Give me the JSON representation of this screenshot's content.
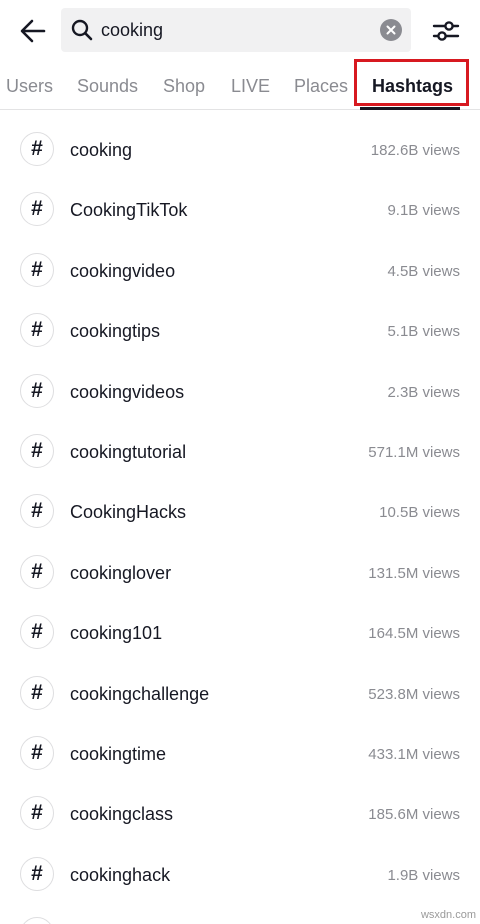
{
  "search": {
    "query": "cooking"
  },
  "tabs": [
    {
      "label": "Users"
    },
    {
      "label": "Sounds"
    },
    {
      "label": "Shop"
    },
    {
      "label": "LIVE"
    },
    {
      "label": "Places"
    },
    {
      "label": "Hashtags",
      "active": true
    }
  ],
  "hashtags": [
    {
      "name": "cooking",
      "views": "182.6B views"
    },
    {
      "name": "CookingTikTok",
      "views": "9.1B views"
    },
    {
      "name": "cookingvideo",
      "views": "4.5B views"
    },
    {
      "name": "cookingtips",
      "views": "5.1B views"
    },
    {
      "name": "cookingvideos",
      "views": "2.3B views"
    },
    {
      "name": "cookingtutorial",
      "views": "571.1M views"
    },
    {
      "name": "CookingHacks",
      "views": "10.5B views"
    },
    {
      "name": "cookinglover",
      "views": "131.5M views"
    },
    {
      "name": "cooking101",
      "views": "164.5M views"
    },
    {
      "name": "cookingchallenge",
      "views": "523.8M views"
    },
    {
      "name": "cookingtime",
      "views": "433.1M views"
    },
    {
      "name": "cookingclass",
      "views": "185.6M views"
    },
    {
      "name": "cookinghack",
      "views": "1.9B views"
    }
  ],
  "hash_symbol": "#",
  "watermark": "wsxdn.com",
  "icons": {
    "back": "back-arrow-icon",
    "search": "search-icon",
    "clear": "clear-icon",
    "filter": "filter-sliders-icon"
  },
  "colors": {
    "highlight": "#d71920",
    "text": "#161823",
    "muted": "#8a8b91",
    "search_bg": "#f1f1f2"
  }
}
